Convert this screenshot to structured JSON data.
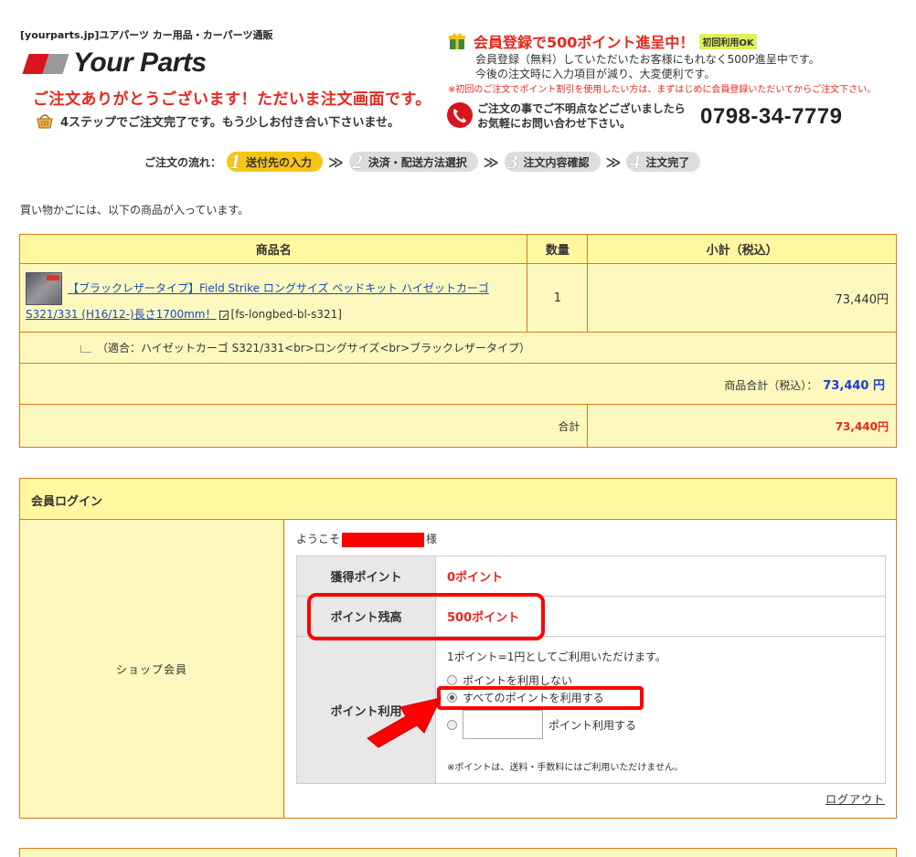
{
  "header": {
    "site_tag": "[yourparts.jp]ユアパーツ カー用品・カーパーツ通販",
    "logo_text": "Your Parts",
    "thanks_message": "ご注文ありがとうございます！ただいま注文画面です。",
    "steps_note": "4ステップでご注文完了です。もう少しお付き合い下さいませ。",
    "member_title": "会員登録で500ポイント進呈中！",
    "member_badge": "初回利用OK",
    "member_line1": "会員登録（無料）していただいたお客様にもれなく500P進呈中です。",
    "member_line2": "今後の注文時に入力項目が減り、大変便利です。",
    "member_warning": "※初回のご注文でポイント割引を使用したい方は、まずはじめに会員登録いただいてからご注文下さい。",
    "contact_line1": "ご注文の事でご不明点などございましたら",
    "contact_line2": "お気軽にお問い合わせ下さい。",
    "phone_number": "0798-34-7779"
  },
  "flow": {
    "label": "ご注文の流れ：",
    "steps": [
      {
        "num": "1",
        "label": "送付先の入力"
      },
      {
        "num": "2",
        "label": "決済・配送方法選択"
      },
      {
        "num": "3",
        "label": "注文内容確認"
      },
      {
        "num": "4",
        "label": "注文完了"
      }
    ],
    "arrow": "≫"
  },
  "cart_intro": "買い物かごには、以下の商品が入っています。",
  "cart": {
    "headers": {
      "name": "商品名",
      "qty": "数量",
      "subtotal": "小計（税込）"
    },
    "item": {
      "name": "【ブラックレザータイプ】Field Strike ロングサイズ ベッドキット ハイゼットカーゴ S321/331 (H16/12-)長さ1700mm！",
      "code": "[fs-longbed-bl-s321]",
      "qty": "1",
      "subtotal": "73,440円"
    },
    "option": "（適合：ハイゼットカーゴ S321/331<br>ロングサイズ<br>ブラックレザータイプ）",
    "product_total_label": "商品合計（税込）：",
    "product_total_value": "73,440 円",
    "total_label": "合計",
    "total_value": "73,440円"
  },
  "login": {
    "title": "会員ログイン",
    "left_label": "ショップ会員",
    "welcome_prefix": "ようこそ",
    "welcome_suffix": "様",
    "earned_label": "獲得ポイント",
    "earned_value": "0ポイント",
    "balance_label": "ポイント残高",
    "balance_value": "500ポイント",
    "use_label": "ポイント利用",
    "use_note": "1ポイント=1円としてご利用いただけます。",
    "option_none": "ポイントを利用しない",
    "option_all": "すべてのポイントを利用する",
    "option_custom_suffix": "ポイント利用する",
    "custom_value": "",
    "use_warning": "※ポイントは、送料・手数料にはご利用いただけません。",
    "logout": "ログアウト"
  },
  "colors": {
    "accent_red": "#e8271c",
    "table_bg": "#fdf9be",
    "table_border": "#e0761c",
    "link_blue": "#1a47c4",
    "active_step": "#f6c514"
  }
}
